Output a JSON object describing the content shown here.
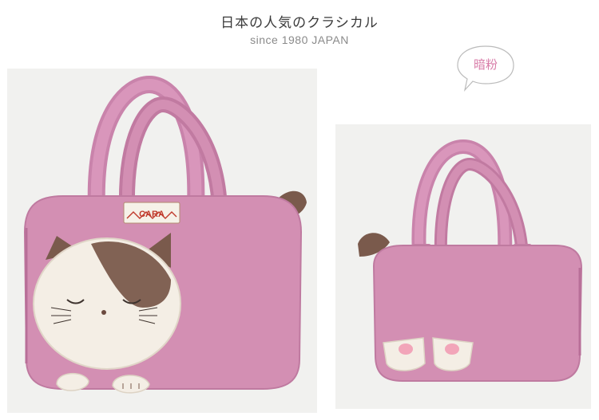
{
  "header": {
    "title": "日本の人気のクラシカル",
    "subtitle": "since 1980 JAPAN"
  },
  "color_label": "暗粉",
  "brand_tag": "CARA",
  "colors": {
    "accent_pink": "#d87ca8",
    "bag_pink": "#d38fb3",
    "bag_pink_dark": "#bf7aa0",
    "photo_bg": "#f1f1ef",
    "ear_brown": "#7a5a4c"
  },
  "photos": [
    {
      "name": "bag-front-photo",
      "view": "front"
    },
    {
      "name": "bag-back-photo",
      "view": "back"
    }
  ]
}
